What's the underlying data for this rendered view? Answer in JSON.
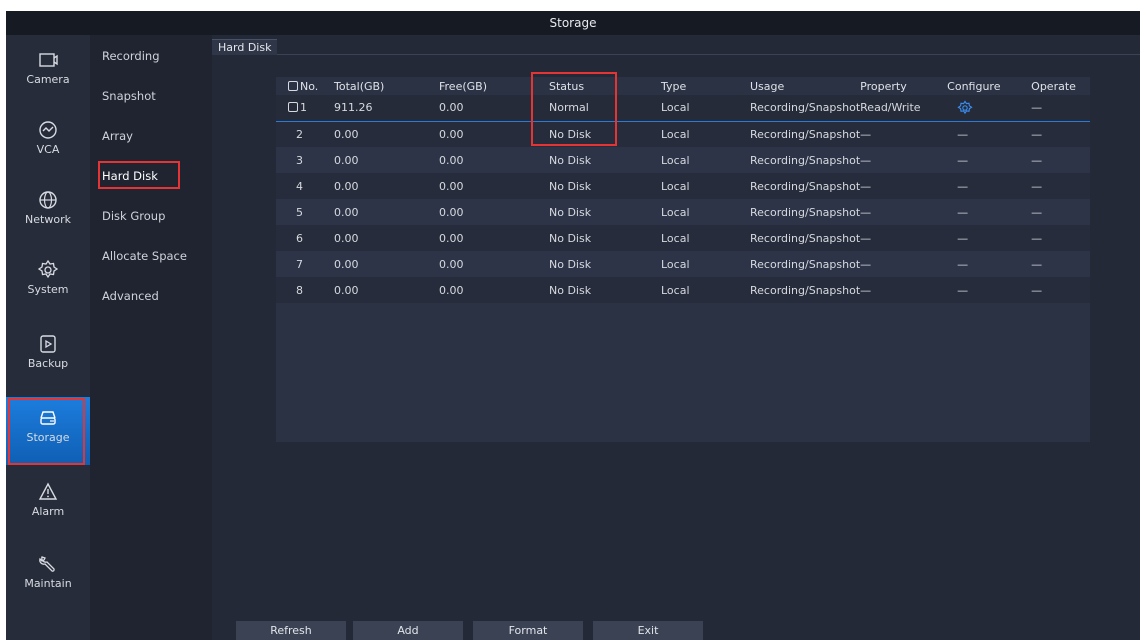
{
  "window": {
    "title": "Storage"
  },
  "nav": {
    "items": [
      {
        "label": "Camera",
        "icon": "camera-icon"
      },
      {
        "label": "VCA",
        "icon": "vca-icon"
      },
      {
        "label": "Network",
        "icon": "globe-icon"
      },
      {
        "label": "System",
        "icon": "gear-icon"
      },
      {
        "label": "Backup",
        "icon": "backup-icon"
      },
      {
        "label": "Storage",
        "icon": "hdd-icon"
      },
      {
        "label": "Alarm",
        "icon": "warning-icon"
      },
      {
        "label": "Maintain",
        "icon": "wrench-icon"
      }
    ],
    "active": "Storage"
  },
  "submenu": {
    "items": [
      "Recording",
      "Snapshot",
      "Array",
      "Hard Disk",
      "Disk Group",
      "Allocate Space",
      "Advanced"
    ],
    "active": "Hard Disk"
  },
  "tab": {
    "label": "Hard Disk"
  },
  "table": {
    "headers": [
      "No.",
      "Total(GB)",
      "Free(GB)",
      "Status",
      "Type",
      "Usage",
      "Property",
      "Configure",
      "Operate"
    ],
    "rows": [
      {
        "no": "1",
        "total": "911.26",
        "free": "0.00",
        "status": "Normal",
        "type": "Local",
        "usage": "Recording/Snapshot",
        "property": "Read/Write",
        "configure": "gear-icon",
        "operate": "—"
      },
      {
        "no": "2",
        "total": "0.00",
        "free": "0.00",
        "status": "No Disk",
        "type": "Local",
        "usage": "Recording/Snapshot",
        "property": "—",
        "configure": "—",
        "operate": "—"
      },
      {
        "no": "3",
        "total": "0.00",
        "free": "0.00",
        "status": "No Disk",
        "type": "Local",
        "usage": "Recording/Snapshot",
        "property": "—",
        "configure": "—",
        "operate": "—"
      },
      {
        "no": "4",
        "total": "0.00",
        "free": "0.00",
        "status": "No Disk",
        "type": "Local",
        "usage": "Recording/Snapshot",
        "property": "—",
        "configure": "—",
        "operate": "—"
      },
      {
        "no": "5",
        "total": "0.00",
        "free": "0.00",
        "status": "No Disk",
        "type": "Local",
        "usage": "Recording/Snapshot",
        "property": "—",
        "configure": "—",
        "operate": "—"
      },
      {
        "no": "6",
        "total": "0.00",
        "free": "0.00",
        "status": "No Disk",
        "type": "Local",
        "usage": "Recording/Snapshot",
        "property": "—",
        "configure": "—",
        "operate": "—"
      },
      {
        "no": "7",
        "total": "0.00",
        "free": "0.00",
        "status": "No Disk",
        "type": "Local",
        "usage": "Recording/Snapshot",
        "property": "—",
        "configure": "—",
        "operate": "—"
      },
      {
        "no": "8",
        "total": "0.00",
        "free": "0.00",
        "status": "No Disk",
        "type": "Local",
        "usage": "Recording/Snapshot",
        "property": "—",
        "configure": "—",
        "operate": "—"
      }
    ]
  },
  "buttons": {
    "refresh": "Refresh",
    "add": "Add",
    "format": "Format",
    "exit": "Exit"
  },
  "colors": {
    "accent": "#1d7ddd",
    "highlight": "#e53434",
    "background": "#232936"
  }
}
